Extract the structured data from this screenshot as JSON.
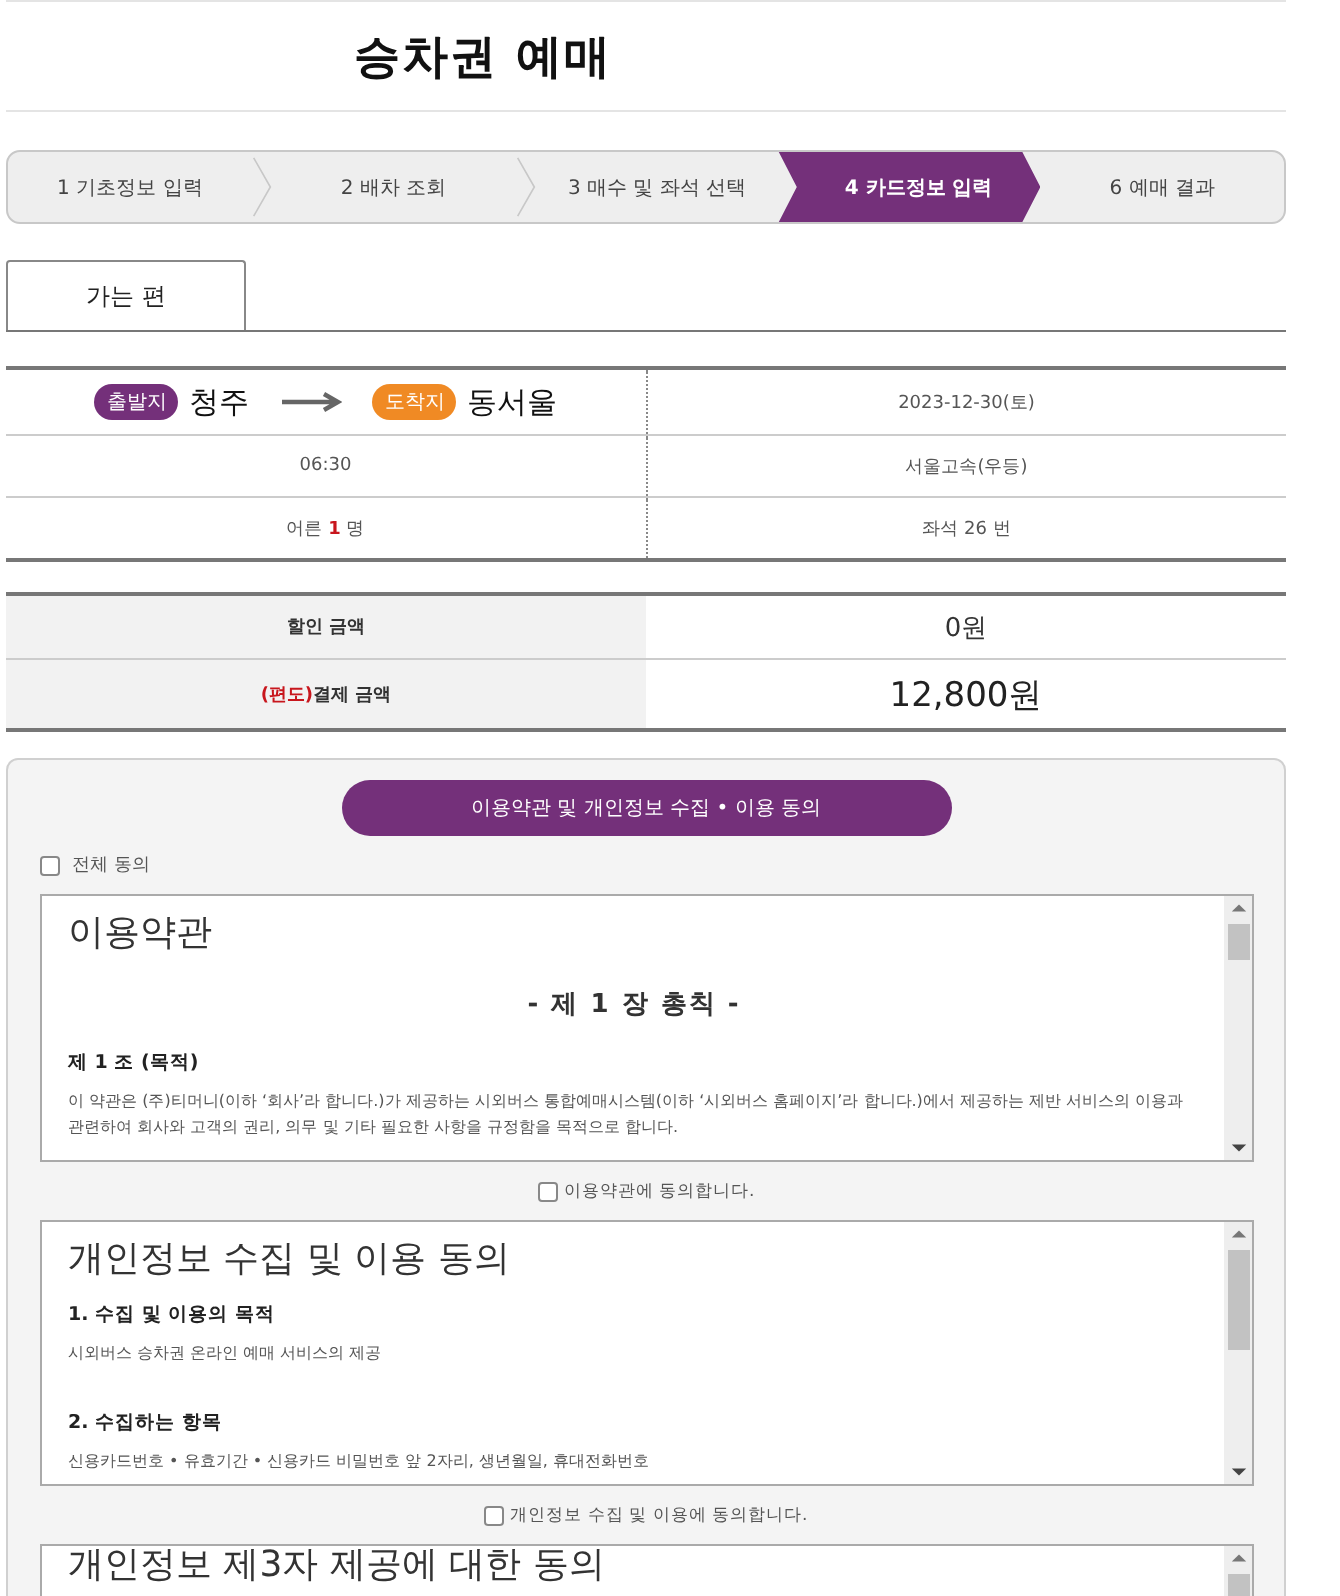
{
  "page_title": "승차권 예매",
  "steps": [
    {
      "label": "1 기초정보 입력",
      "selected": false
    },
    {
      "label": "2 배차 조회",
      "selected": false
    },
    {
      "label": "3 매수 및 좌석 선택",
      "selected": false
    },
    {
      "label": "4 카드정보 입력",
      "selected": true
    },
    {
      "label": "6 예매 결과",
      "selected": false
    }
  ],
  "tabs": [
    {
      "label": "가는 편",
      "selected": true
    }
  ],
  "trip": {
    "departure_badge": "출발지",
    "departure": "청주",
    "arrival_badge": "도착지",
    "arrival": "동서울",
    "date": "2023-12-30(토)",
    "time": "06:30",
    "company": "서울고속(우등)",
    "passenger_type": "어른",
    "passenger_count": "1",
    "passenger_unit": "명",
    "seat": "좌석 26 번"
  },
  "fare": [
    {
      "kind": "discount",
      "label": "할인 금액",
      "amount": "0원"
    },
    {
      "kind": "total",
      "prefix": "(편도)",
      "label": "결제 금액",
      "amount": "12,800원"
    }
  ],
  "agreement": {
    "heading": "이용약관 및 개인정보 수집 • 이용 동의",
    "agree_all": {
      "label": "전체 동의",
      "checked": false
    },
    "documents": [
      {
        "title": "이용약관",
        "blocks": [
          {
            "kind": "chapter",
            "text": "- 제 1 장 총칙 -"
          },
          {
            "kind": "subheading",
            "text": "제 1 조 (목적)"
          },
          {
            "kind": "paragraph",
            "text": "이 약관은 (주)티머니(이하 ‘회사’라 합니다.)가 제공하는 시외버스 통합예매시스템(이하 ‘시외버스 홈페이지’라 합니다.)에서 제공하는 제반 서비스의 이용과 관련하여 회사와 고객의 권리, 의무 및 기타 필요한 사항을 규정함을 목적으로 합니다."
          }
        ],
        "consent": {
          "label": "이용약관에 동의합니다.",
          "checked": false
        }
      },
      {
        "title": "개인정보 수집 및 이용 동의",
        "blocks": [
          {
            "kind": "subheading",
            "text": "1. 수집 및 이용의 목적"
          },
          {
            "kind": "paragraph",
            "text": "시외버스 승차권 온라인 예매 서비스의 제공"
          },
          {
            "kind": "subheading",
            "text": "2. 수집하는 항목"
          },
          {
            "kind": "paragraph",
            "text": "신용카드번호 • 유효기간 • 신용카드 비밀번호 앞 2자리, 생년월일, 휴대전화번호"
          }
        ],
        "consent": {
          "label": "개인정보 수집 및 이용에 동의합니다.",
          "checked": false
        }
      },
      {
        "title": "개인정보 제3자 제공에 대한 동의"
      }
    ]
  }
}
